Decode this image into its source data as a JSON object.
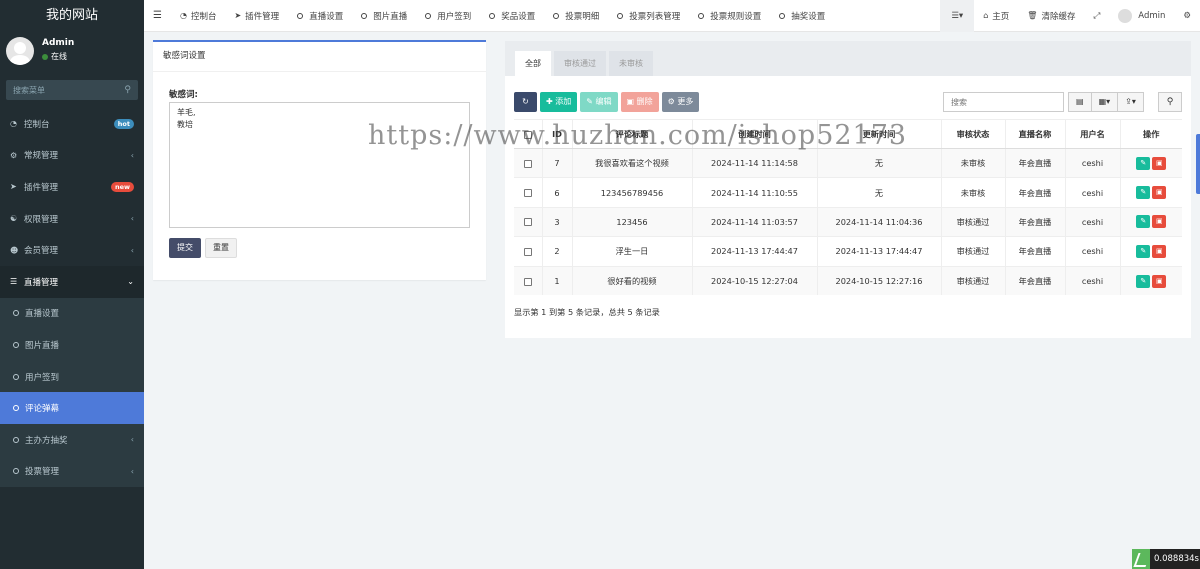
{
  "sidebar": {
    "brand": "我的网站",
    "user": {
      "name": "Admin",
      "status": "在线"
    },
    "search_placeholder": "搜索菜单",
    "items": [
      {
        "label": "控制台",
        "icon": "dashboard-icon",
        "badge": "hot",
        "badge_color": "#3c8dbc"
      },
      {
        "label": "常规管理",
        "icon": "cogs-icon"
      },
      {
        "label": "插件管理",
        "icon": "rocket-icon",
        "badge": "new",
        "badge_color": "#e74c3c"
      },
      {
        "label": "权限管理",
        "icon": "group-icon"
      },
      {
        "label": "会员管理",
        "icon": "user-circle-icon"
      },
      {
        "label": "直播管理",
        "icon": "list-icon"
      }
    ],
    "sub_items": [
      {
        "label": "直播设置"
      },
      {
        "label": "图片直播"
      },
      {
        "label": "用户签到"
      },
      {
        "label": "评论弹幕"
      },
      {
        "label": "主办方抽奖"
      },
      {
        "label": "投票管理"
      }
    ]
  },
  "topnav": {
    "items": [
      {
        "label": "控制台",
        "icon": "dashboard-icon"
      },
      {
        "label": "插件管理",
        "icon": "rocket-icon"
      },
      {
        "label": "直播设置",
        "icon": "circle-icon"
      },
      {
        "label": "图片直播",
        "icon": "circle-icon"
      },
      {
        "label": "用户签到",
        "icon": "circle-icon"
      },
      {
        "label": "奖品设置",
        "icon": "circle-icon"
      },
      {
        "label": "投票明细",
        "icon": "circle-icon"
      },
      {
        "label": "投票列表管理",
        "icon": "circle-icon"
      },
      {
        "label": "投票规则设置",
        "icon": "circle-icon"
      },
      {
        "label": "抽奖设置",
        "icon": "circle-icon"
      }
    ],
    "home": "主页",
    "clear_cache": "清除缓存",
    "user": "Admin"
  },
  "left_panel": {
    "title": "敏感词设置",
    "field_label": "敏感词:",
    "textarea_value": "羊毛,\n教培",
    "submit": "提交",
    "reset": "重置"
  },
  "right_panel": {
    "tabs": [
      "全部",
      "审核通过",
      "未审核"
    ],
    "toolbar": {
      "add": "添加",
      "edit": "编辑",
      "delete": "删除",
      "more": "更多"
    },
    "search_placeholder": "搜索",
    "columns": [
      "ID",
      "评论标题",
      "创建时间",
      "更新时间",
      "审核状态",
      "直播名称",
      "用户名",
      "操作"
    ],
    "rows": [
      {
        "id": "7",
        "title": "我很喜欢看这个视频",
        "created": "2024-11-14 11:14:58",
        "updated": "无",
        "status": "未审核",
        "live": "年会直播",
        "user": "ceshi"
      },
      {
        "id": "6",
        "title": "123456789456",
        "created": "2024-11-14 11:10:55",
        "updated": "无",
        "status": "未审核",
        "live": "年会直播",
        "user": "ceshi"
      },
      {
        "id": "3",
        "title": "123456",
        "created": "2024-11-14 11:03:57",
        "updated": "2024-11-14 11:04:36",
        "status": "审核通过",
        "live": "年会直播",
        "user": "ceshi"
      },
      {
        "id": "2",
        "title": "浮生一日",
        "created": "2024-11-13 17:44:47",
        "updated": "2024-11-13 17:44:47",
        "status": "审核通过",
        "live": "年会直播",
        "user": "ceshi"
      },
      {
        "id": "1",
        "title": "很好看的视频",
        "created": "2024-10-15 12:27:04",
        "updated": "2024-10-15 12:27:16",
        "status": "审核通过",
        "live": "年会直播",
        "user": "ceshi"
      }
    ],
    "pagination_text": "显示第 1 到第 5 条记录，总共 5 条记录"
  },
  "watermark": "https://www.huzhan.com/ishop52173",
  "timer": "0.088834s",
  "colors": {
    "sidebar_bg": "#222d32",
    "accent": "#4e7ad9",
    "success": "#18bc9c",
    "danger": "#e74c3c"
  }
}
